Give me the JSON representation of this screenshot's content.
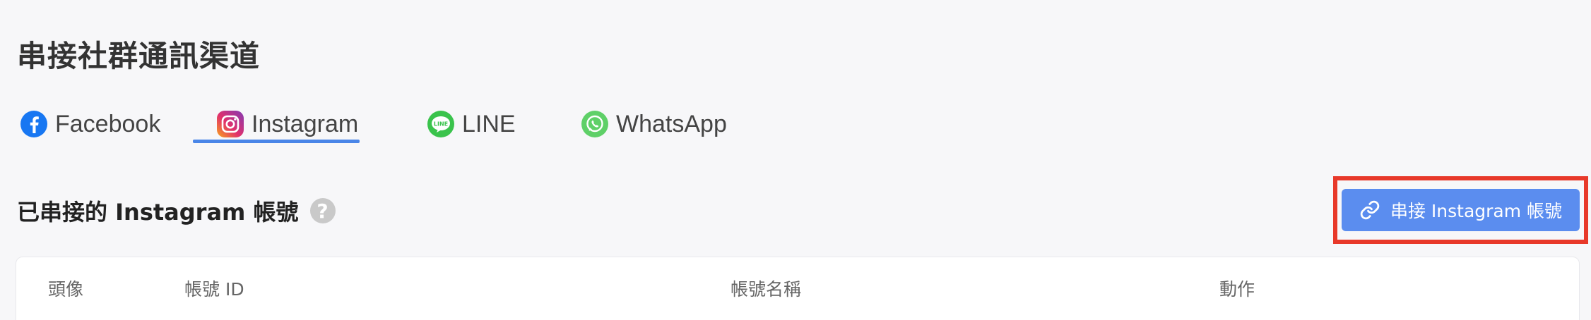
{
  "page": {
    "title": "串接社群通訊渠道"
  },
  "tabs": [
    {
      "label": "Facebook",
      "icon": "facebook-icon",
      "color": "#1877f2",
      "active": false
    },
    {
      "label": "Instagram",
      "icon": "instagram-icon",
      "color": "#d62976",
      "active": true
    },
    {
      "label": "LINE",
      "icon": "line-icon",
      "color": "#3ac34c",
      "active": false
    },
    {
      "label": "WhatsApp",
      "icon": "whatsapp-icon",
      "color": "#5fd068",
      "active": false
    }
  ],
  "section": {
    "title": "已串接的 Instagram 帳號",
    "help_icon": "question-icon"
  },
  "connect_button": {
    "label": "串接 Instagram 帳號",
    "icon": "link-icon",
    "color": "#5b8def",
    "highlight_color": "#e8392a"
  },
  "table": {
    "columns": [
      "頭像",
      "帳號 ID",
      "帳號名稱",
      "動作"
    ]
  },
  "colors": {
    "accent": "#4a86e8",
    "background": "#f7f7f9"
  }
}
